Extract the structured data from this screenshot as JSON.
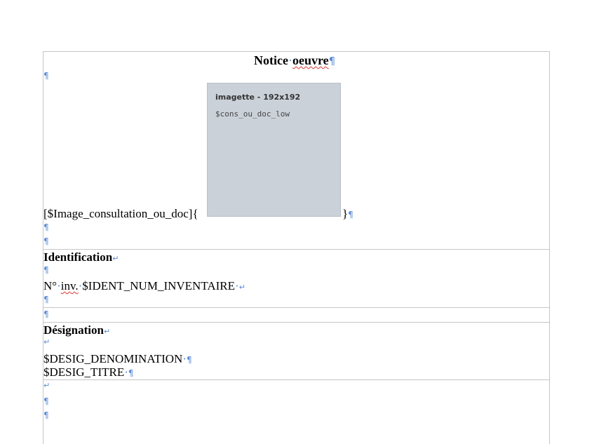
{
  "title": {
    "text": "Notice",
    "word": "oeuvre",
    "pilcrow": "¶"
  },
  "marks": {
    "pilcrow": "¶",
    "return": "↵"
  },
  "image_field": {
    "prefix": "[$Image_consultation_ou_doc]{",
    "suffix": "}",
    "placeholder_title": "imagette - 192x192",
    "placeholder_var": "$cons_ou_doc_low"
  },
  "identification": {
    "heading": "Identification",
    "label": "N°",
    "abbr": "inv.",
    "value": "$IDENT_NUM_INVENTAIRE"
  },
  "designation": {
    "heading": "Désignation",
    "line1": "$DESIG_DENOMINATION",
    "line2": "$DESIG_TITRE"
  }
}
